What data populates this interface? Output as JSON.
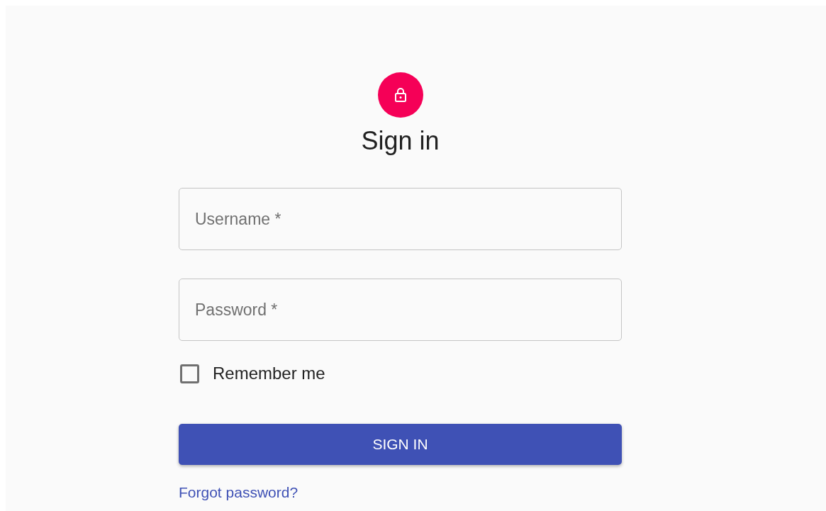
{
  "title": "Sign in",
  "fields": [
    {
      "placeholder": "Username *"
    },
    {
      "placeholder": "Password *"
    }
  ],
  "remember": {
    "label": "Remember me",
    "checked": false
  },
  "button": "SIGN IN",
  "link": "Forgot password?"
}
